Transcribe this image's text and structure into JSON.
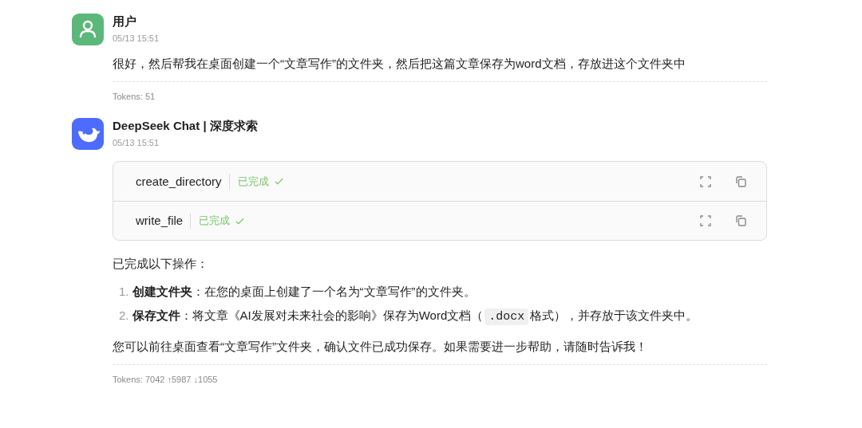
{
  "messages": [
    {
      "kind": "user",
      "name": "用户",
      "time": "05/13 15:51",
      "text": "很好，然后帮我在桌面创建一个“文章写作”的文件夹，然后把这篇文章保存为word文档，存放进这个文件夹中",
      "tokens": "Tokens: 51"
    },
    {
      "kind": "assistant",
      "name": "DeepSeek Chat | 深度求索",
      "time": "05/13 15:51",
      "tool_calls": [
        {
          "name": "create_directory",
          "status": "已完成"
        },
        {
          "name": "write_file",
          "status": "已完成"
        }
      ],
      "intro": "已完成以下操作：",
      "list": [
        {
          "number": "1.",
          "segments": [
            {
              "kind": "text",
              "text": "**创建文件夹**：在您的桌面上创建了一个名为“文章写作”的文件夹。"
            }
          ]
        },
        {
          "number": "2.",
          "segments": [
            {
              "kind": "text",
              "text": "**保存文件**：将文章《AI发展对未来社会的影响》保存为Word文档（"
            },
            {
              "kind": "code",
              "text": ".docx"
            },
            {
              "kind": "text",
              "text": "格式），并存放于该文件夹中。"
            }
          ]
        }
      ],
      "outro": "您可以前往桌面查看“文章写作”文件夹，确认文件已成功保存。如果需要进一步帮助，请随时告诉我！",
      "tokens": "Tokens: 7042 ↑5987 ↓1055"
    }
  ]
}
